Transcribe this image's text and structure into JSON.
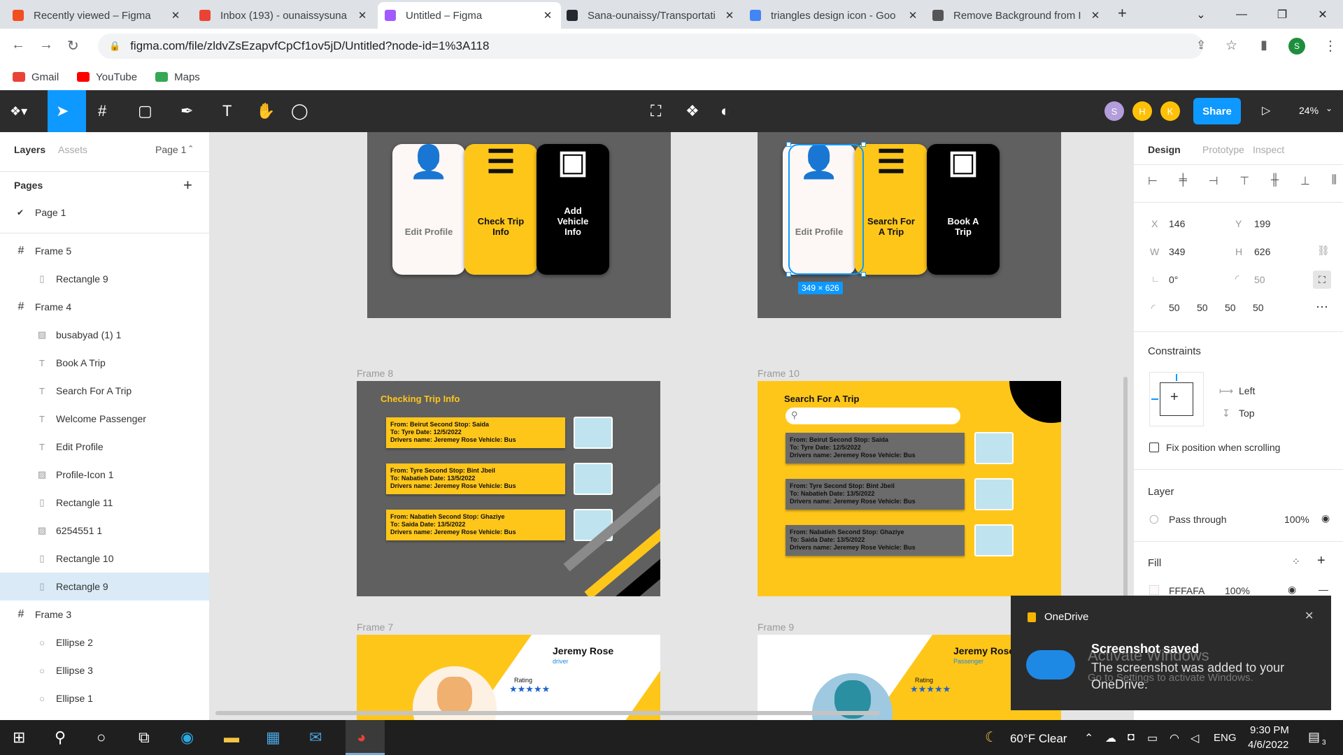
{
  "browser": {
    "tabs": [
      {
        "title": "Recently viewed – Figma",
        "color": "#f24e1e",
        "active": false
      },
      {
        "title": "Inbox (193) - ounaissysuna",
        "color": "#ea4335",
        "active": false
      },
      {
        "title": "Untitled – Figma",
        "color": "#a259ff",
        "active": true
      },
      {
        "title": "Sana-ounaissy/Transportati",
        "color": "#24292f",
        "active": false
      },
      {
        "title": "triangles design icon - Goo",
        "color": "#4285f4",
        "active": false
      },
      {
        "title": "Remove Background from I",
        "color": "#555555",
        "active": false
      }
    ],
    "new_tab": "+",
    "url": "figma.com/file/zldvZsEzapvfCpCf1ov5jD/Untitled?node-id=1%3A118",
    "profile": "S",
    "bookmarks": [
      "Gmail",
      "YouTube",
      "Maps"
    ]
  },
  "figma": {
    "avatars": [
      {
        "letter": "S",
        "color": "#b39ddb"
      },
      {
        "letter": "H",
        "color": "#ffc107"
      },
      {
        "letter": "K",
        "color": "#ffc107"
      }
    ],
    "share_label": "Share",
    "zoom": "24%"
  },
  "left_panel": {
    "tab_layers": "Layers",
    "tab_assets": "Assets",
    "page_select": "Page 1",
    "pages_heading": "Pages",
    "pages": [
      "Page 1"
    ],
    "layers": [
      {
        "name": "Frame 5",
        "type": "frame",
        "indent": 0
      },
      {
        "name": "Rectangle 9",
        "type": "rect",
        "indent": 1
      },
      {
        "name": "Frame 4",
        "type": "frame",
        "indent": 0
      },
      {
        "name": "busabyad (1) 1",
        "type": "image",
        "indent": 1
      },
      {
        "name": "Book A Trip",
        "type": "text",
        "indent": 1
      },
      {
        "name": "Search For A Trip",
        "type": "text",
        "indent": 1
      },
      {
        "name": "Welcome Passenger",
        "type": "text",
        "indent": 1
      },
      {
        "name": "Edit Profile",
        "type": "text",
        "indent": 1
      },
      {
        "name": "Profile-Icon 1",
        "type": "image",
        "indent": 1
      },
      {
        "name": "Rectangle 11",
        "type": "rect",
        "indent": 1
      },
      {
        "name": "6254551 1",
        "type": "image",
        "indent": 1
      },
      {
        "name": "Rectangle 10",
        "type": "rect",
        "indent": 1
      },
      {
        "name": "Rectangle 9",
        "type": "rect",
        "indent": 1,
        "selected": true
      },
      {
        "name": "Frame 3",
        "type": "frame",
        "indent": 0
      },
      {
        "name": "Ellipse 2",
        "type": "ellipse",
        "indent": 1
      },
      {
        "name": "Ellipse 3",
        "type": "ellipse",
        "indent": 1
      },
      {
        "name": "Ellipse 1",
        "type": "ellipse",
        "indent": 1
      }
    ]
  },
  "canvas": {
    "frame_left_cards": [
      {
        "label": "Edit Profile",
        "bg": "#fdf8f6",
        "fg": "#777777"
      },
      {
        "label": "Check Trip Info",
        "bg": "#ffc61a",
        "fg": "#111111"
      },
      {
        "label": "Add Vehicle Info",
        "bg": "#000000",
        "fg": "#ffffff"
      }
    ],
    "frame_right_cards": [
      {
        "label": "Edit Profile",
        "bg": "#fdf8f6",
        "fg": "#777777"
      },
      {
        "label": "Search For A Trip",
        "bg": "#ffc61a",
        "fg": "#111111"
      },
      {
        "label": "Book A Trip",
        "bg": "#000000",
        "fg": "#ffffff"
      }
    ],
    "selection_size": "349 × 626",
    "frame8": {
      "name": "Frame 8",
      "title": "Checking Trip Info",
      "rows": [
        [
          "From: Beirut    Second Stop: Saida",
          "To: Tyre     Date: 12/5/2022",
          "Drivers name: Jeremey Rose   Vehicle: Bus"
        ],
        [
          "From: Tyre    Second Stop: Bint Jbeil",
          "To: Nabatieh    Date: 13/5/2022",
          "Drivers name: Jeremey Rose   Vehicle: Bus"
        ],
        [
          "From: Nabatieh   Second Stop: Ghaziye",
          "To: Saida    Date: 13/5/2022",
          "Drivers name: Jeremey Rose   Vehicle: Bus"
        ]
      ]
    },
    "frame10": {
      "name": "Frame 10",
      "title": "Search For A Trip",
      "rows": [
        [
          "From: Beirut   Second Stop: Saida",
          "To: Tyre    Date: 12/5/2022",
          "Drivers name: Jeremey Rose   Vehicle: Bus"
        ],
        [
          "From: Tyre    Second Stop: Bint Jbeil",
          "To: Nabatieh    Date: 13/5/2022",
          "Drivers name: Jeremey Rose   Vehicle: Bus"
        ],
        [
          "From: Nabatieh   Second Stop: Ghaziye",
          "To: Saida    Date: 13/5/2022",
          "Drivers name: Jeremey Rose   Vehicle: Bus"
        ]
      ]
    },
    "frame7": {
      "name": "Frame 7",
      "person": "Jeremy Rose",
      "role": "driver",
      "rating_label": "Rating",
      "stars": "★★★★★"
    },
    "frame9": {
      "name": "Frame 9",
      "person": "Jeremy Rose",
      "role": "Passenger",
      "rating_label": "Rating",
      "stars": "★★★★★"
    }
  },
  "right_panel": {
    "tabs": [
      "Design",
      "Prototype",
      "Inspect"
    ],
    "x_label": "X",
    "x": "146",
    "y_label": "Y",
    "y": "199",
    "w_label": "W",
    "w": "349",
    "h_label": "H",
    "h": "626",
    "rotation": "0°",
    "corner": "50",
    "corners": [
      "50",
      "50",
      "50",
      "50"
    ],
    "constraints_heading": "Constraints",
    "constraint_h": "Left",
    "constraint_v": "Top",
    "fix_position": "Fix position when scrolling",
    "layer_heading": "Layer",
    "blend": "Pass through",
    "layer_opacity": "100%",
    "fill_heading": "Fill",
    "fill_hex": "FFFAFA",
    "fill_opacity": "100%"
  },
  "toast": {
    "app": "OneDrive",
    "title": "Screenshot saved",
    "body": "The screenshot was added to your OneDrive.",
    "watermark1": "Activate Windows",
    "watermark2": "Go to Settings to activate Windows."
  },
  "taskbar": {
    "weather": "60°F  Clear",
    "lang": "ENG",
    "time": "9:30 PM",
    "date": "4/6/2022",
    "notif_count": "3"
  }
}
